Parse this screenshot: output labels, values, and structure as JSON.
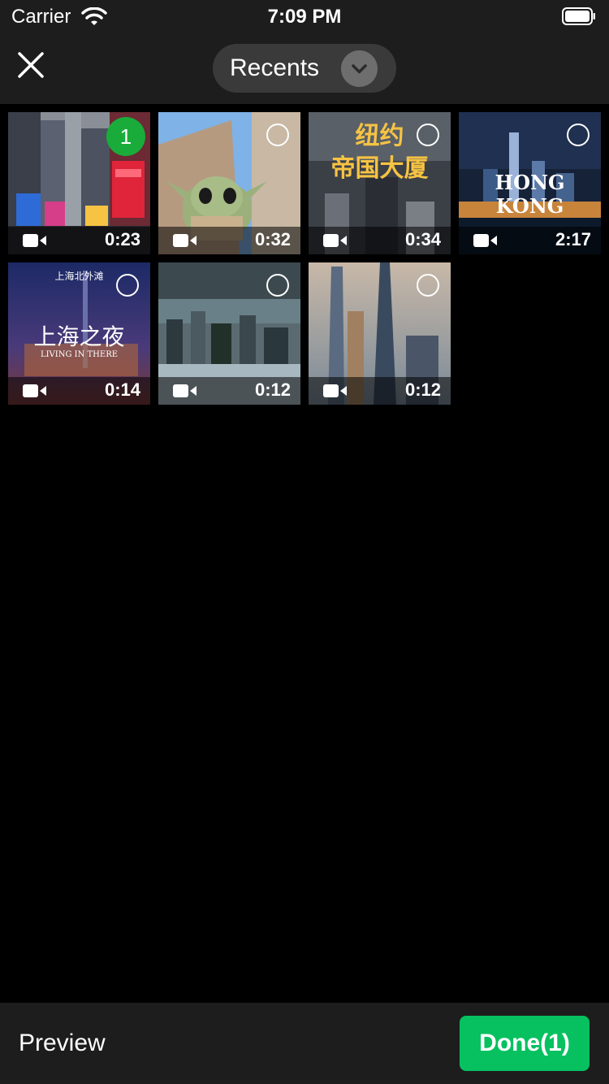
{
  "status": {
    "carrier": "Carrier",
    "time": "7:09 PM"
  },
  "nav": {
    "album": "Recents"
  },
  "grid": {
    "items": [
      {
        "duration": "0:23",
        "selected_index": "1"
      },
      {
        "duration": "0:32"
      },
      {
        "duration": "0:34",
        "overlay_text": "纽约\n帝国大厦"
      },
      {
        "duration": "2:17",
        "overlay_text": "HONG KONG"
      },
      {
        "duration": "0:14",
        "overlay_top": "上海北外滩",
        "overlay_main": "上海之夜",
        "overlay_sub": "LIVING IN THERE"
      },
      {
        "duration": "0:12"
      },
      {
        "duration": "0:12"
      }
    ]
  },
  "bottom": {
    "preview_label": "Preview",
    "done_label": "Done(1)"
  },
  "colors": {
    "accent": "#07c160",
    "badge": "#1aac3a",
    "bar": "#1d1d1d"
  },
  "icons": {
    "close": "close-icon",
    "chevron": "chevron-down-icon",
    "video": "video-camera-icon",
    "wifi": "wifi-icon",
    "battery": "battery-icon"
  }
}
